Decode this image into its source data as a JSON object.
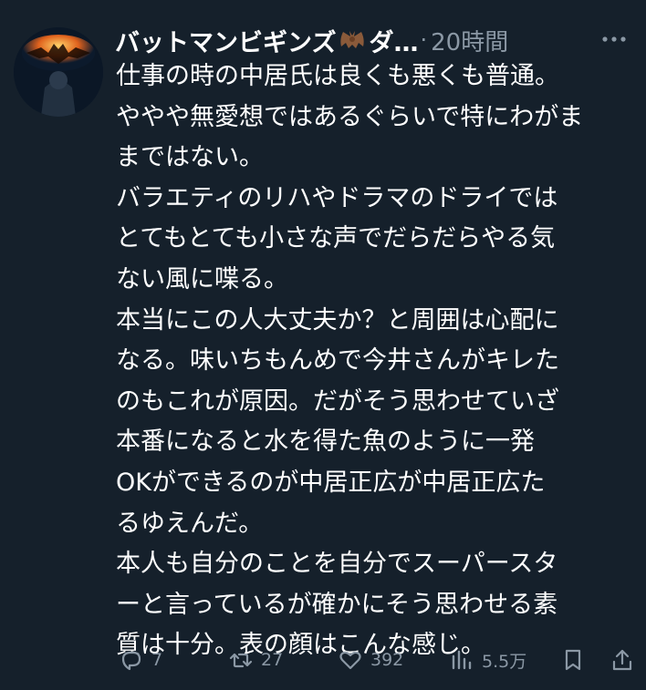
{
  "tweet": {
    "author_name": "バットマンビギンズ",
    "author_name_suffix": "ダ…",
    "separator": "·",
    "time": "20時間",
    "lines": [
      "仕事の時の中居氏は良くも悪くも普通。",
      "ややや無愛想ではあるぐらいで特にわがま",
      "まではない。",
      "バラエティのリハやドラマのドライでは",
      "とてもとても小さな声でだらだらやる気",
      "ない風に喋る。",
      "本当にこの人大丈夫か？と周囲は心配に",
      "なる。味いちもんめで今井さんがキレた",
      "のもこれが原因。だがそう思わせていざ",
      "本番になると水を得た魚のように一発",
      "OKができるのが中居正広が中居正広た",
      "るゆえんだ。",
      "本人も自分のことを自分でスーパースタ",
      "ーと言っているが確かにそう思わせる素",
      "質は十分。表の顔はこんな感じ。"
    ]
  },
  "actions": {
    "replies": "7",
    "reposts": "27",
    "likes": "392",
    "views": "5.5万"
  },
  "icons": [
    "avatar",
    "bat-emoji-icon",
    "more-icon",
    "reply-icon",
    "repost-icon",
    "like-icon",
    "views-icon",
    "bookmark-icon",
    "share-icon"
  ],
  "colors": {
    "background": "#15202b",
    "text": "#ffffff",
    "muted": "#8b98a5"
  }
}
